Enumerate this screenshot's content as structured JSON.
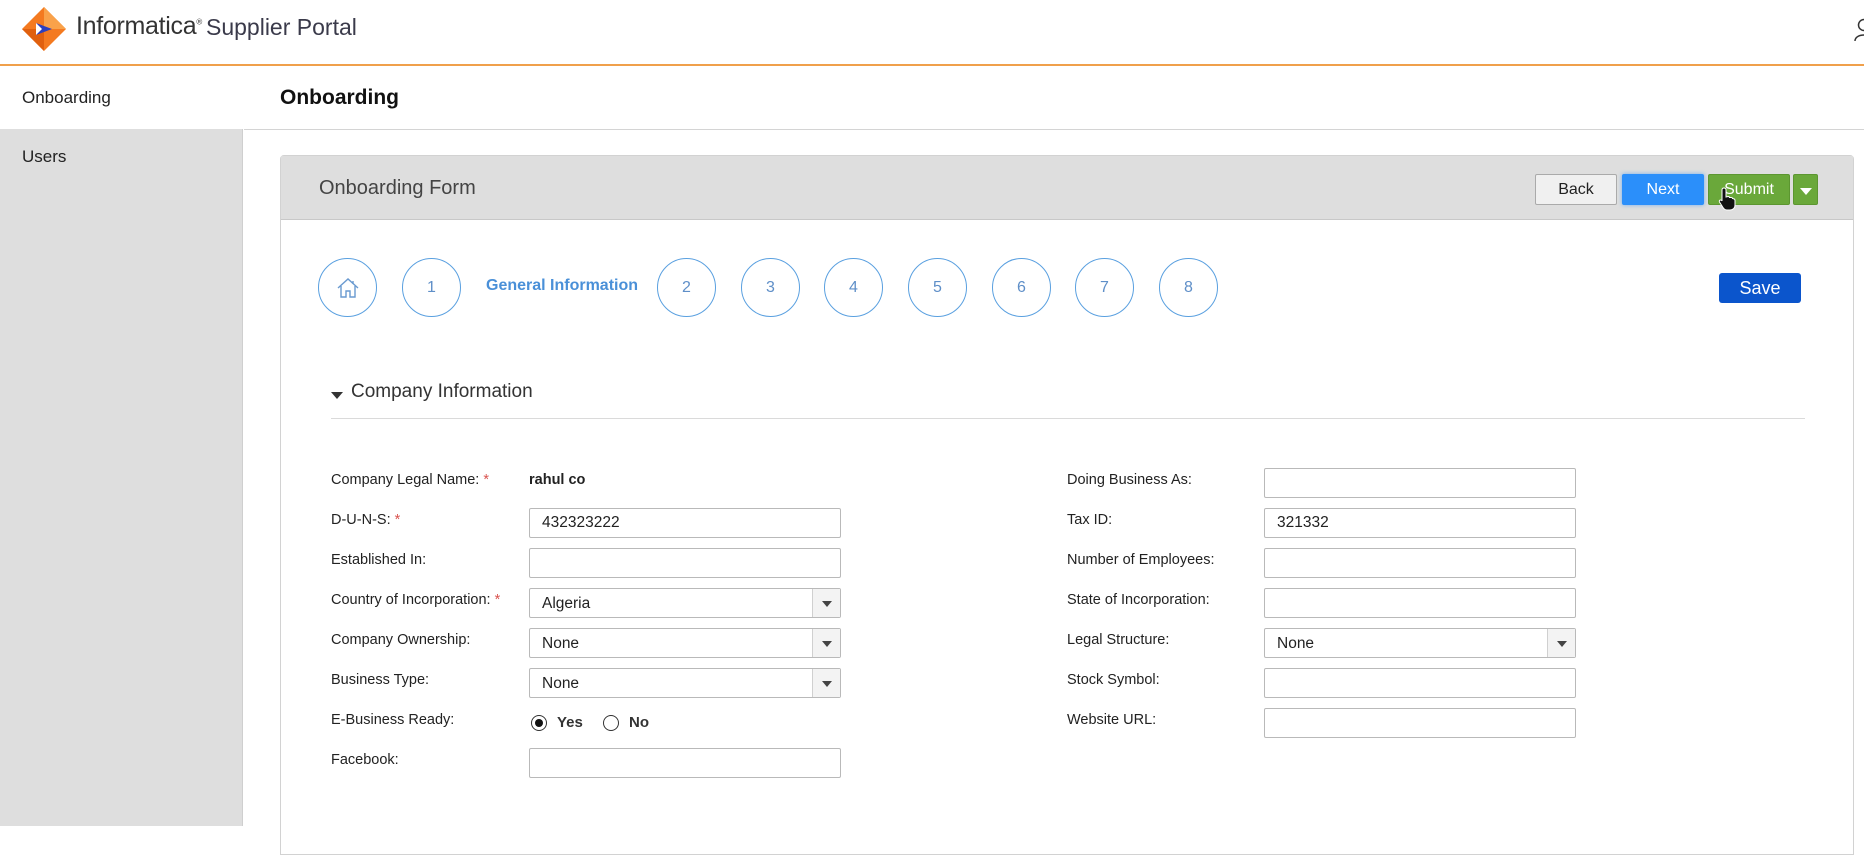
{
  "header": {
    "brand": "Informatica",
    "trademark": "®",
    "portal_name": "Supplier Portal",
    "user_icon": "user-icon",
    "accent_color": "#f0a04b"
  },
  "sidebar": {
    "items": [
      {
        "label": "Onboarding",
        "active": true
      },
      {
        "label": "Users",
        "active": false
      }
    ]
  },
  "main": {
    "title": "Onboarding"
  },
  "form": {
    "title": "Onboarding Form",
    "buttons": {
      "back": "Back",
      "next": "Next",
      "submit": "Submit",
      "save": "Save"
    },
    "steps": [
      {
        "label": "home-icon",
        "type": "icon"
      },
      {
        "label": "1"
      },
      {
        "label": "General Information",
        "current": true
      },
      {
        "label": "2"
      },
      {
        "label": "3"
      },
      {
        "label": "4"
      },
      {
        "label": "5"
      },
      {
        "label": "6"
      },
      {
        "label": "7"
      },
      {
        "label": "8"
      }
    ],
    "section": {
      "title": "Company Information",
      "expanded": true
    },
    "left_fields": [
      {
        "label": "Company Legal Name:",
        "required": true,
        "type": "static",
        "value": "rahul co"
      },
      {
        "label": "D-U-N-S:",
        "required": true,
        "type": "text",
        "value": "432323222"
      },
      {
        "label": "Established In:",
        "required": false,
        "type": "text",
        "value": ""
      },
      {
        "label": "Country of Incorporation:",
        "required": true,
        "type": "select",
        "value": "Algeria"
      },
      {
        "label": "Company Ownership:",
        "required": false,
        "type": "select",
        "value": "None"
      },
      {
        "label": "Business Type:",
        "required": false,
        "type": "select",
        "value": "None"
      },
      {
        "label": "E-Business Ready:",
        "required": false,
        "type": "radio",
        "options": [
          "Yes",
          "No"
        ],
        "value": "Yes"
      },
      {
        "label": "Facebook:",
        "required": false,
        "type": "text",
        "value": ""
      }
    ],
    "right_fields": [
      {
        "label": "Doing Business As:",
        "type": "text",
        "value": ""
      },
      {
        "label": "Tax ID:",
        "type": "text",
        "value": "321332"
      },
      {
        "label": "Number of Employees:",
        "type": "text",
        "value": ""
      },
      {
        "label": "State of Incorporation:",
        "type": "text",
        "value": ""
      },
      {
        "label": "Legal Structure:",
        "type": "select",
        "value": "None"
      },
      {
        "label": "Stock Symbol:",
        "type": "text",
        "value": ""
      },
      {
        "label": "Website URL:",
        "type": "text",
        "value": ""
      }
    ],
    "required_marker": "*"
  },
  "colors": {
    "next_button": "#2b8ffa",
    "submit_button": "#6aa83a",
    "save_button": "#0b55cc",
    "step_border": "#5aa0e0",
    "required": "#d9534f"
  }
}
